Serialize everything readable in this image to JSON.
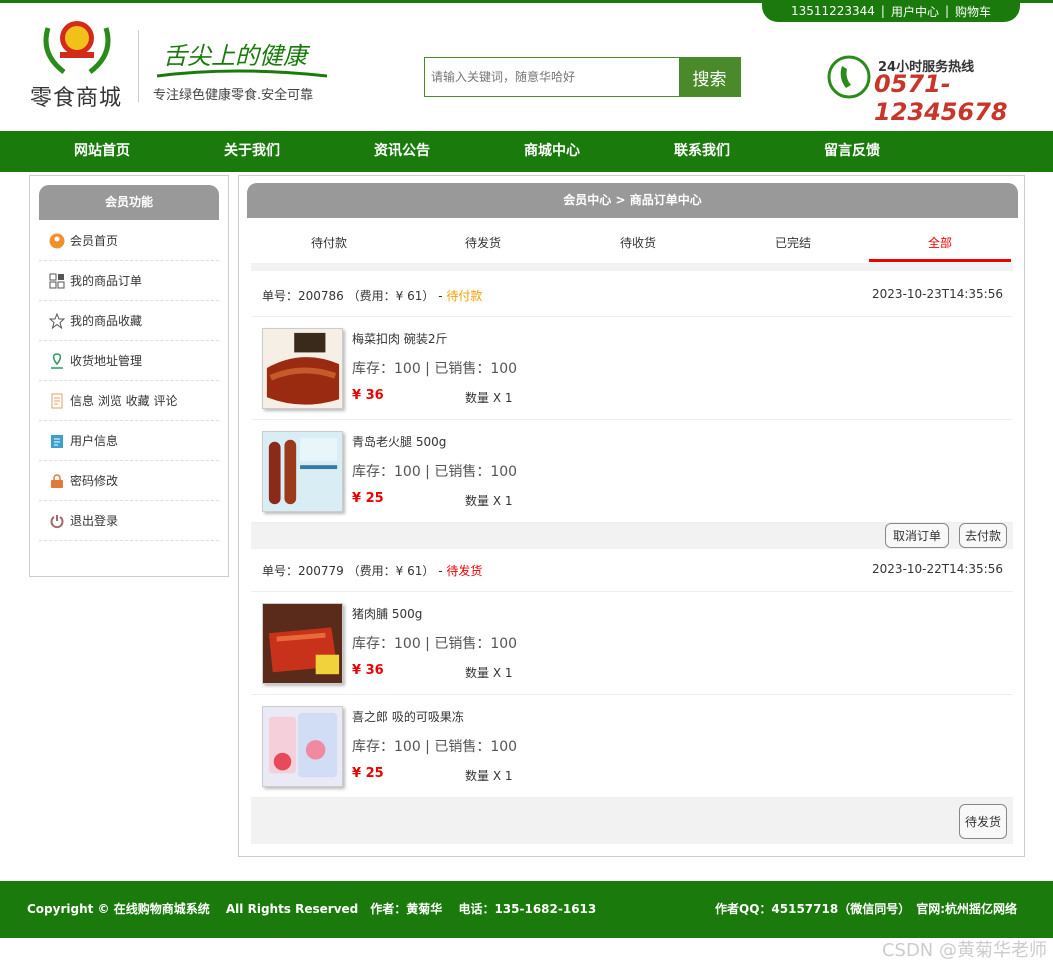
{
  "top_links": {
    "phone": "13511223344",
    "sep1": "|",
    "user_center": "用户中心",
    "sep2": "|",
    "cart": "购物车"
  },
  "header": {
    "logo_text": "零食商城",
    "slogan_script": "舌尖上的健康",
    "slogan_sub": "专注绿色健康零食.安全可靠",
    "search": {
      "placeholder": "请输入关键词，随意华哈好",
      "button": "搜索"
    },
    "hotline_label": "24小时服务热线",
    "hotline_number": "0571-12345678"
  },
  "nav": [
    "网站首页",
    "关于我们",
    "资讯公告",
    "商城中心",
    "联系我们",
    "留言反馈"
  ],
  "sidebar": {
    "title": "会员功能",
    "items": [
      {
        "label": "会员首页",
        "icon": "user-home-icon"
      },
      {
        "label": "我的商品订单",
        "icon": "grid-icon"
      },
      {
        "label": "我的商品收藏",
        "icon": "star-icon"
      },
      {
        "label": "收货地址管理",
        "icon": "location-icon"
      },
      {
        "label": "信息 浏览 收藏 评论",
        "icon": "document-icon"
      },
      {
        "label": "用户信息",
        "icon": "clipboard-icon"
      },
      {
        "label": "密码修改",
        "icon": "lock-icon"
      },
      {
        "label": "退出登录",
        "icon": "power-icon"
      }
    ]
  },
  "main": {
    "breadcrumb": "会员中心 > 商品订单中心",
    "tabs": [
      "待付款",
      "待发货",
      "待收货",
      "已完结",
      "全部"
    ],
    "active_tab": "全部",
    "orders": [
      {
        "number_label": "单号：200786",
        "fee": "（费用：¥ 61）",
        "dash": "-",
        "status": "待付款",
        "time": "2023-10-23T14:35:56",
        "items": [
          {
            "name": "梅菜扣肉 碗装2斤",
            "stock": "库存：100 | 已销售：100",
            "price": "¥ 36",
            "qty": "数量 X 1"
          },
          {
            "name": "青岛老火腿 500g",
            "stock": "库存：100 | 已销售：100",
            "price": "¥ 25",
            "qty": "数量 X 1"
          }
        ],
        "buttons": [
          "取消订单",
          "去付款"
        ]
      },
      {
        "number_label": "单号：200779",
        "fee": "（费用：¥ 61）",
        "dash": "-",
        "status": "待发货",
        "time": "2023-10-22T14:35:56",
        "items": [
          {
            "name": "猪肉脯 500g",
            "stock": "库存：100 | 已销售：100",
            "price": "¥ 36",
            "qty": "数量 X 1"
          },
          {
            "name": "喜之郎 吸的可吸果冻",
            "stock": "库存：100 | 已销售：100",
            "price": "¥ 25",
            "qty": "数量 X 1"
          }
        ],
        "buttons": [
          "待发货"
        ]
      }
    ]
  },
  "footer": {
    "left": "Copyright © 在线购物商城系统　 All Rights Reserved　作者：黄菊华　 电话：135-1682-1613",
    "right": "作者QQ：45157718（微信同号）　官网:杭州摇亿网络"
  },
  "watermark": "CSDN @黄菊华老师",
  "colors": {
    "brand_green": "#1a7a0c",
    "accent_red": "#e00000",
    "pending_orange": "#f0a000",
    "hotline_red": "#c8362a"
  }
}
